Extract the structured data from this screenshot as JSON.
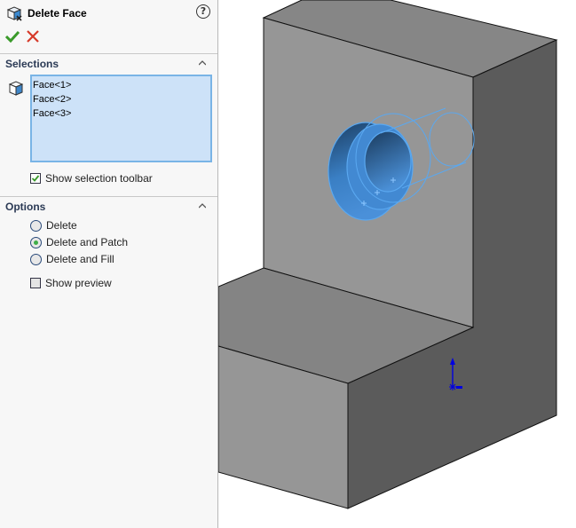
{
  "panel": {
    "title": "Delete Face",
    "help_icon": "question-icon",
    "ok_icon": "checkmark-icon",
    "cancel_icon": "close-icon",
    "selections": {
      "title": "Selections",
      "items": [
        "Face<1>",
        "Face<2>",
        "Face<3>"
      ],
      "show_selection_toolbar_label": "Show selection toolbar",
      "show_selection_toolbar_checked": true
    },
    "options": {
      "title": "Options",
      "radios": [
        {
          "label": "Delete",
          "selected": false
        },
        {
          "label": "Delete and Patch",
          "selected": true
        },
        {
          "label": "Delete and Fill",
          "selected": false
        }
      ],
      "show_preview_label": "Show preview",
      "show_preview_checked": false
    }
  },
  "colors": {
    "accent_blue": "#4a90d9",
    "ok_green": "#3a9a2a",
    "cancel_red": "#d63a2a",
    "highlight_edge": "#5aa8f0",
    "triad_blue": "#0000e0"
  }
}
